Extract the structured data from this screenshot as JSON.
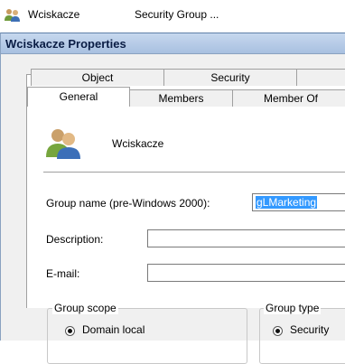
{
  "list_row": {
    "name": "Wciskacze",
    "type": "Security Group ..."
  },
  "dialog": {
    "title": "Wciskacze Properties",
    "tabs_back": [
      "Object",
      "Security",
      ""
    ],
    "tabs_front": [
      "General",
      "Members",
      "Member Of"
    ],
    "active_tab": "General",
    "group_name": "Wciskacze",
    "fields": {
      "prewin_label": "Group name (pre-Windows 2000):",
      "prewin_value": "gLMarketing",
      "description_label": "Description:",
      "description_value": "",
      "email_label": "E-mail:",
      "email_value": ""
    },
    "scope": {
      "title": "Group scope",
      "selected": "Domain local"
    },
    "type": {
      "title": "Group type",
      "selected": "Security"
    }
  },
  "colors": {
    "titlebar": "#b9cde8",
    "title_text": "#0a1d45",
    "selection": "#3399ff",
    "dialog_bg": "#f0f0f0"
  },
  "icons": [
    "group-icon",
    "group-large-icon",
    "radio-selected-icon"
  ]
}
